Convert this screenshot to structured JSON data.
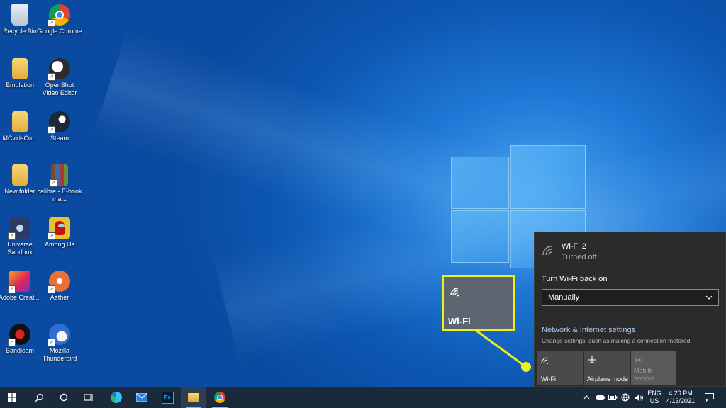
{
  "desktop": {
    "icons": [
      {
        "label": "Recycle Bin",
        "icon": "recycle-bin-icon"
      },
      {
        "label": "Google Chrome",
        "icon": "chrome-icon"
      },
      {
        "label": "Emulation",
        "icon": "folder-icon"
      },
      {
        "label": "OpenShot Video Editor",
        "icon": "openshot-icon"
      },
      {
        "label": "MCvidsCo...",
        "icon": "folder-icon"
      },
      {
        "label": "Steam",
        "icon": "steam-icon"
      },
      {
        "label": "New folder",
        "icon": "folder-icon"
      },
      {
        "label": "calibre - E-book ma...",
        "icon": "calibre-icon"
      },
      {
        "label": "Universe Sandbox",
        "icon": "universe-sandbox-icon"
      },
      {
        "label": "Among Us",
        "icon": "among-us-icon"
      },
      {
        "label": "Adobe Creati...",
        "icon": "adobe-creative-cloud-icon"
      },
      {
        "label": "Aether",
        "icon": "aether-icon"
      },
      {
        "label": "Bandicam",
        "icon": "bandicam-icon"
      },
      {
        "label": "Mozilla Thunderbird",
        "icon": "thunderbird-icon"
      }
    ]
  },
  "callout": {
    "label": "Wi-Fi",
    "icon": "wifi-icon",
    "color": "#f2ee1e"
  },
  "network_flyout": {
    "network_name": "Wi-Fi 2",
    "network_status": "Turned off",
    "turn_back_on_label": "Turn Wi-Fi back on",
    "turn_back_on_value": "Manually",
    "settings_link": "Network & Internet settings",
    "settings_description": "Change settings, such as making a connection metered.",
    "quick_actions": [
      {
        "label": "Wi-Fi",
        "icon": "wifi-icon"
      },
      {
        "label": "Airplane mode",
        "icon": "airplane-icon"
      },
      {
        "label": "Mobile hotspot",
        "icon": "mobile-hotspot-icon"
      }
    ]
  },
  "taskbar": {
    "language_top": "ENG",
    "language_bottom": "US",
    "time": "4:20 PM",
    "date": "4/13/2021",
    "accent_color": "#7fb6e8"
  }
}
